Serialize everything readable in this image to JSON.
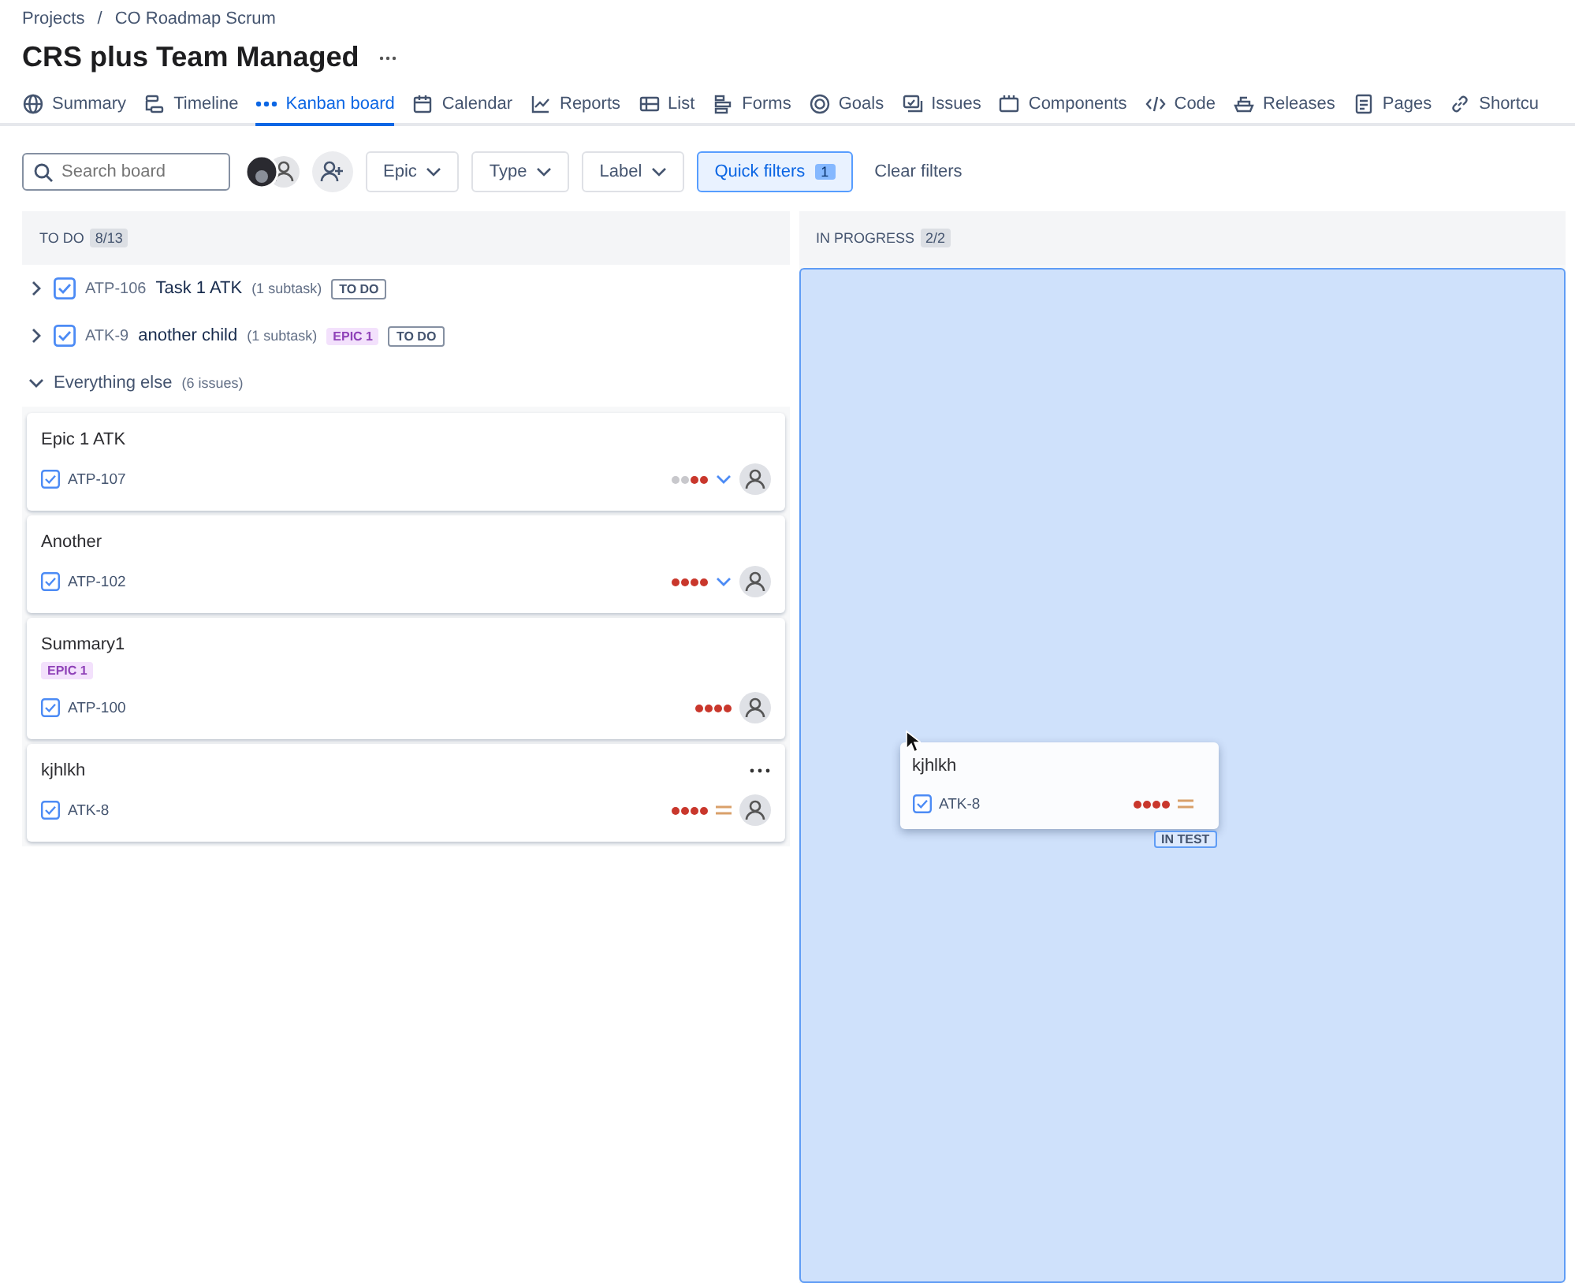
{
  "breadcrumbs": [
    "Projects",
    "CO Roadmap Scrum"
  ],
  "breadcrumb_separator": "/",
  "title": "CRS plus Team Managed",
  "tabs": [
    {
      "label": "Summary",
      "selected": false
    },
    {
      "label": "Timeline",
      "selected": false
    },
    {
      "label": "Kanban board",
      "selected": true
    },
    {
      "label": "Calendar",
      "selected": false
    },
    {
      "label": "Reports",
      "selected": false
    },
    {
      "label": "List",
      "selected": false
    },
    {
      "label": "Forms",
      "selected": false
    },
    {
      "label": "Goals",
      "selected": false
    },
    {
      "label": "Issues",
      "selected": false
    },
    {
      "label": "Components",
      "selected": false
    },
    {
      "label": "Code",
      "selected": false
    },
    {
      "label": "Releases",
      "selected": false
    },
    {
      "label": "Pages",
      "selected": false
    },
    {
      "label": "Shortcu",
      "selected": false
    }
  ],
  "toolbar": {
    "search": {
      "placeholder": "Search board"
    },
    "filters": [
      "Epic",
      "Type",
      "Label"
    ],
    "quick_filters": {
      "label": "Quick filters",
      "count": "1",
      "selected": true
    },
    "clear": "Clear filters"
  },
  "columns": [
    {
      "title": "TO DO",
      "count": "8/13",
      "drop_target": false,
      "parents": [
        {
          "key": "ATP-106",
          "title": "Task 1 ATK",
          "subtasks": "(1 subtask)",
          "tags": [
            {
              "label": "TO DO",
              "kind": "status"
            }
          ]
        },
        {
          "key": "ATK-9",
          "title": "another child",
          "subtasks": "(1 subtask)",
          "tags": [
            {
              "label": "EPIC 1",
              "kind": "epic"
            },
            {
              "label": "TO DO",
              "kind": "status"
            }
          ]
        }
      ],
      "group": {
        "label": "Everything else",
        "count": "(6 issues)",
        "expanded": true
      },
      "cards": [
        {
          "title": "Epic 1 ATK",
          "key": "ATP-107",
          "level": 0.5,
          "kind": "low"
        },
        {
          "title": "Another",
          "key": "ATP-102",
          "level": 1,
          "kind": "low"
        },
        {
          "title": "Summary1",
          "key": "ATP-100",
          "tags": [
            "EPIC 1"
          ],
          "level": 1,
          "kind": "plain"
        },
        {
          "title": "kjhlkh",
          "key": "ATK-8",
          "level": 1,
          "kind": "medium",
          "menu": true
        }
      ]
    },
    {
      "title": "IN PROGRESS",
      "count": "2/2",
      "drop_target": true
    }
  ],
  "dragged_card": {
    "title": "kjhlkh",
    "key": "ATK-8",
    "level": 1,
    "kind": "medium",
    "status": "IN TEST"
  }
}
